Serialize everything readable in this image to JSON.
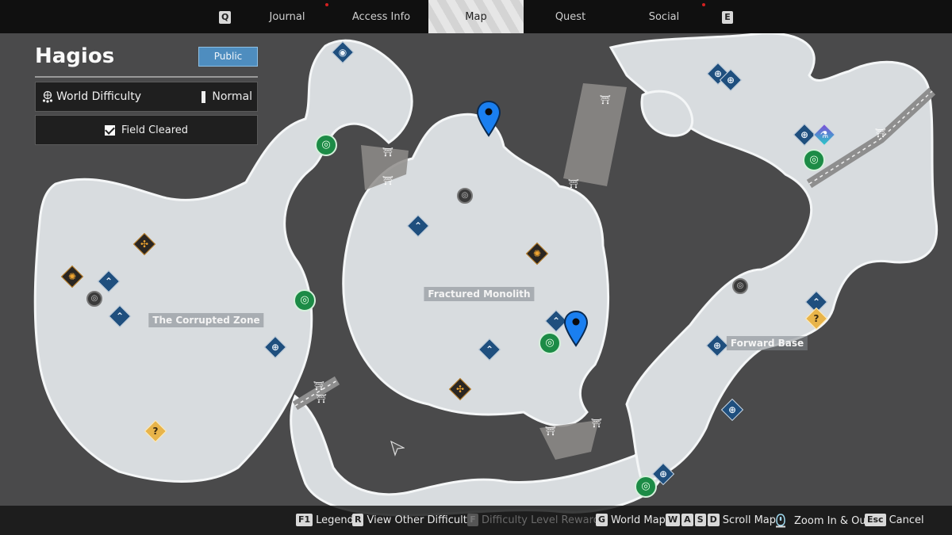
{
  "topbar": {
    "left_key": "Q",
    "right_key": "E",
    "tabs": [
      {
        "label": "Journal",
        "notification": true
      },
      {
        "label": "Access Info",
        "notification": false
      },
      {
        "label": "Map",
        "active": true,
        "notification": false
      },
      {
        "label": "Quest",
        "notification": false
      },
      {
        "label": "Social",
        "notification": true
      }
    ]
  },
  "panel": {
    "region_title": "Hagios",
    "visibility_button": "Public",
    "world_difficulty": {
      "label": "World Difficulty",
      "value": "Normal",
      "icon": "globe-stars-icon"
    },
    "field_status": {
      "label": "Field Cleared",
      "checked": true
    }
  },
  "map": {
    "area_labels": [
      "The Corrupted Zone",
      "Fractured Monolith",
      "Forward Base"
    ],
    "markers": [
      {
        "type": "blue",
        "icon": "signal-icon",
        "glyph": "◉"
      },
      {
        "type": "green",
        "icon": "vulgus-circle-icon",
        "glyph": "◎"
      },
      {
        "type": "orange",
        "icon": "boss-icon",
        "glyph": "✣"
      },
      {
        "type": "orange",
        "icon": "boss-icon",
        "glyph": "✺"
      },
      {
        "type": "blue",
        "icon": "chevron-up-icon",
        "glyph": "⌃"
      },
      {
        "type": "dark",
        "icon": "locked-circle-icon",
        "glyph": "◎"
      },
      {
        "type": "blue",
        "icon": "chevron-up-icon",
        "glyph": "⌃"
      },
      {
        "type": "green",
        "icon": "vulgus-circle-icon",
        "glyph": "◎"
      },
      {
        "type": "blue",
        "icon": "crosshair-icon",
        "glyph": "⊕"
      },
      {
        "type": "yellow",
        "icon": "mystery-icon",
        "glyph": "?"
      },
      {
        "type": "dark",
        "icon": "locked-circle-icon",
        "glyph": "◎"
      },
      {
        "type": "blue",
        "icon": "chevron-up-icon",
        "glyph": "⌃"
      },
      {
        "type": "orange",
        "icon": "boss-icon",
        "glyph": "✺"
      },
      {
        "type": "blue",
        "icon": "chevron-up-icon",
        "glyph": "⌃"
      },
      {
        "type": "blue",
        "icon": "chevron-up-icon",
        "glyph": "⌃"
      },
      {
        "type": "green",
        "icon": "vulgus-circle-icon",
        "glyph": "◎"
      },
      {
        "type": "orange",
        "icon": "boss-icon",
        "glyph": "✣"
      },
      {
        "type": "blue",
        "icon": "crosshair-icon",
        "glyph": "⊕"
      },
      {
        "type": "blue",
        "icon": "crosshair-icon",
        "glyph": "⊕"
      },
      {
        "type": "blue",
        "icon": "crosshair-icon",
        "glyph": "⊕"
      },
      {
        "type": "purple",
        "icon": "flask-icon",
        "glyph": "⚗"
      },
      {
        "type": "green",
        "icon": "vulgus-circle-icon",
        "glyph": "◎"
      },
      {
        "type": "dark",
        "icon": "locked-circle-icon",
        "glyph": "◎"
      },
      {
        "type": "blue",
        "icon": "chevron-up-icon",
        "glyph": "⌃"
      },
      {
        "type": "yellow",
        "icon": "mystery-icon",
        "glyph": "?"
      },
      {
        "type": "blue",
        "icon": "crosshair-icon",
        "glyph": "⊕"
      },
      {
        "type": "blue",
        "icon": "crosshair-icon",
        "glyph": "⊕"
      },
      {
        "type": "blue",
        "icon": "crosshair-icon",
        "glyph": "⊕"
      },
      {
        "type": "green",
        "icon": "vulgus-circle-icon",
        "glyph": "◎"
      }
    ],
    "pins": 2,
    "pin_color": "#1a7ff0"
  },
  "bottombar": {
    "hints": [
      {
        "keys": [
          "F1"
        ],
        "label": "Legend",
        "enabled": true
      },
      {
        "keys": [
          "R"
        ],
        "label": "View Other Difficulty",
        "enabled": true
      },
      {
        "keys": [
          "F"
        ],
        "label": "Difficulty Level Rewards",
        "enabled": false
      },
      {
        "keys": [
          "G"
        ],
        "label": "World Map",
        "enabled": true
      },
      {
        "keys": [
          "W",
          "A",
          "S",
          "D"
        ],
        "label": "Scroll Map",
        "enabled": true
      },
      {
        "keys": [],
        "label": "Zoom In & Out",
        "enabled": true,
        "icon": "mouse-wheel-icon"
      },
      {
        "keys": [
          "Esc"
        ],
        "label": "Cancel",
        "enabled": true
      }
    ]
  },
  "colors": {
    "accent_blue": "#4e8dbf",
    "notification_red": "#d32020",
    "marker_green": "#1c8b46",
    "marker_blue": "#1f4f7e",
    "marker_orange": "#f0a531"
  }
}
